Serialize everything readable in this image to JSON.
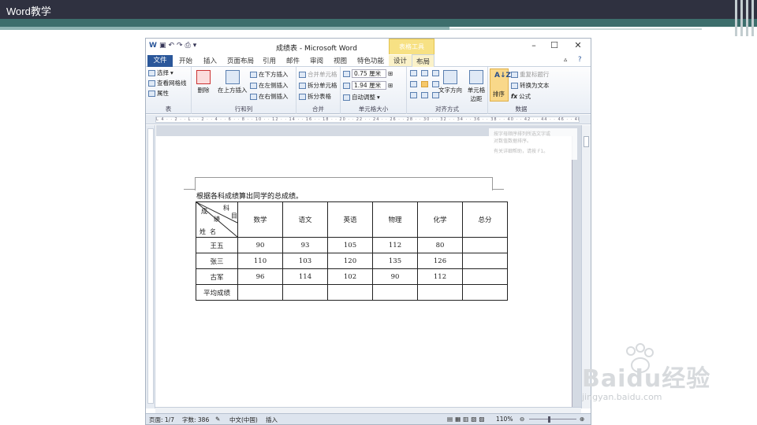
{
  "slide": {
    "title": "Word教学"
  },
  "word": {
    "doc_title": "成绩表 - Microsoft Word",
    "context_tab_group": "表格工具",
    "window_buttons": {
      "minimize": "–",
      "maximize": "☐",
      "close": "✕"
    },
    "tabs": [
      "文件",
      "开始",
      "插入",
      "页面布局",
      "引用",
      "邮件",
      "审阅",
      "视图",
      "特色功能",
      "设计",
      "布局"
    ],
    "active_tab": "布局",
    "ribbon": {
      "table": {
        "label": "表",
        "items": [
          "选择",
          "查看网格线",
          "属性"
        ]
      },
      "rows_cols": {
        "label": "行和列",
        "delete": "删除",
        "insert_above": "在上方插入",
        "insert_below": "在下方插入",
        "insert_left": "在左侧插入",
        "insert_right": "在右侧插入"
      },
      "merge": {
        "label": "合并",
        "merge_cells": "合并单元格",
        "split_cells": "拆分单元格",
        "split_table": "拆分表格"
      },
      "cell_size": {
        "label": "单元格大小",
        "height": "0.75 厘米",
        "width": "1.94 厘米",
        "autofit": "自动调整"
      },
      "alignment": {
        "label": "对齐方式",
        "text_direction": "文字方向",
        "cell_margins": "单元格边距"
      },
      "data": {
        "label": "数据",
        "sort": "排序",
        "repeat_header": "重复标题行",
        "convert_text": "转换为文本",
        "formula": "公式"
      }
    },
    "ruler_text": "L 4 · · 2 · · L · · 2 · · 4 · · 6 · · 8 · · 10 · · 12 · · 14 · · 16 · · 18 · · 20 · · 22 · · 24 · · 26 · · 28 · · 30 · · 32 · · 34 · · 36 · · 38 · · 40 · · 42 · · 44 · · 46 · · 48",
    "tooltip": [
      "按字母顺序排列所选文字或",
      "对数值数据排序。",
      "有关详细帮助，请按 F1。"
    ],
    "document": {
      "instruction": "根据各科成绩算出同学的总成绩。",
      "header_diag": {
        "subject": "科目",
        "score": "成绩",
        "name": "姓名",
        "ke": "科",
        "mu": "目",
        "cheng": "成",
        "ji": "绩",
        "xing": "姓",
        "ming": "名"
      },
      "columns": [
        "数学",
        "语文",
        "英语",
        "物理",
        "化学",
        "总分"
      ],
      "rows": [
        {
          "name": "王五",
          "scores": [
            "90",
            "93",
            "105",
            "112",
            "80",
            ""
          ]
        },
        {
          "name": "张三",
          "scores": [
            "110",
            "103",
            "120",
            "135",
            "126",
            ""
          ]
        },
        {
          "name": "古军",
          "scores": [
            "96",
            "114",
            "102",
            "90",
            "112",
            ""
          ]
        },
        {
          "name": "平均成绩",
          "scores": [
            "",
            "",
            "",
            "",
            "",
            ""
          ]
        }
      ]
    },
    "status": {
      "page": "页面: 1/7",
      "words": "字数: 386",
      "lang": "中文(中国)",
      "mode": "插入",
      "zoom": "110%"
    }
  },
  "watermark": {
    "brand": "Baidu经验",
    "url": "jingyan.baidu.com"
  }
}
